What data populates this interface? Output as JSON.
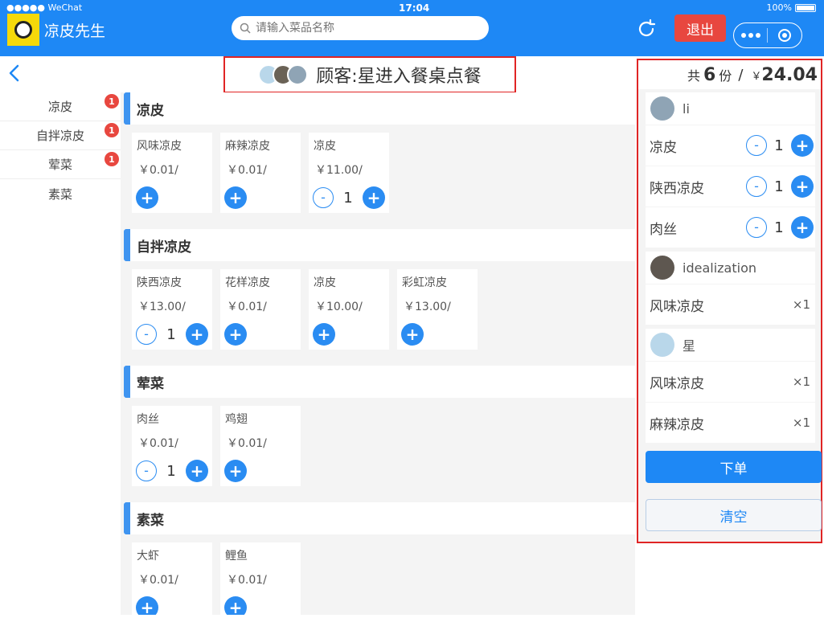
{
  "status": {
    "carrier": "●●●●● WeChat",
    "time": "17:04",
    "battery": "100%"
  },
  "app": {
    "title": "凉皮先生",
    "logout_label": "退出"
  },
  "search": {
    "placeholder": "请输入菜品名称"
  },
  "banner": {
    "text": "顾客:星进入餐桌点餐"
  },
  "categories": [
    {
      "label": "凉皮",
      "badge": "1"
    },
    {
      "label": "自拌凉皮",
      "badge": "1"
    },
    {
      "label": "荤菜",
      "badge": "1"
    },
    {
      "label": "素菜",
      "badge": ""
    }
  ],
  "sections": [
    {
      "title": "凉皮",
      "items": [
        {
          "name": "风味凉皮",
          "price": "￥0.01/",
          "qty": null
        },
        {
          "name": "麻辣凉皮",
          "price": "￥0.01/",
          "qty": null
        },
        {
          "name": "凉皮",
          "price": "￥11.00/",
          "qty": "1"
        }
      ]
    },
    {
      "title": "自拌凉皮",
      "items": [
        {
          "name": "陕西凉皮",
          "price": "￥13.00/",
          "qty": "1"
        },
        {
          "name": "花样凉皮",
          "price": "￥0.01/",
          "qty": null
        },
        {
          "name": "凉皮",
          "price": "￥10.00/",
          "qty": null
        },
        {
          "name": "彩虹凉皮",
          "price": "￥13.00/",
          "qty": null
        }
      ]
    },
    {
      "title": "荤菜",
      "items": [
        {
          "name": "肉丝",
          "price": "￥0.01/",
          "qty": "1"
        },
        {
          "name": "鸡翅",
          "price": "￥0.01/",
          "qty": null
        }
      ]
    },
    {
      "title": "素菜",
      "items": [
        {
          "name": "大虾",
          "price": "￥0.01/",
          "qty": null
        },
        {
          "name": "鲤鱼",
          "price": "￥0.01/",
          "qty": null
        }
      ]
    }
  ],
  "cart": {
    "count_prefix": "共",
    "count": "6",
    "count_suffix": "份",
    "slash": "/",
    "yen": "￥",
    "total": "24.04",
    "users": [
      {
        "name": "li",
        "items": [
          {
            "name": "凉皮",
            "qty": "1",
            "editable": true
          },
          {
            "name": "陕西凉皮",
            "qty": "1",
            "editable": true
          },
          {
            "name": "肉丝",
            "qty": "1",
            "editable": true
          }
        ]
      },
      {
        "name": "idealization",
        "items": [
          {
            "name": "风味凉皮",
            "qty": "×1",
            "editable": false
          }
        ]
      },
      {
        "name": "星",
        "items": [
          {
            "name": "风味凉皮",
            "qty": "×1",
            "editable": false
          },
          {
            "name": "麻辣凉皮",
            "qty": "×1",
            "editable": false
          }
        ]
      }
    ],
    "order_label": "下单",
    "clear_label": "清空"
  },
  "icons": {
    "plus": "+",
    "minus": "-"
  },
  "colors": {
    "primary": "#1e88f5",
    "danger": "#e8473f",
    "highlight": "#e02525"
  }
}
